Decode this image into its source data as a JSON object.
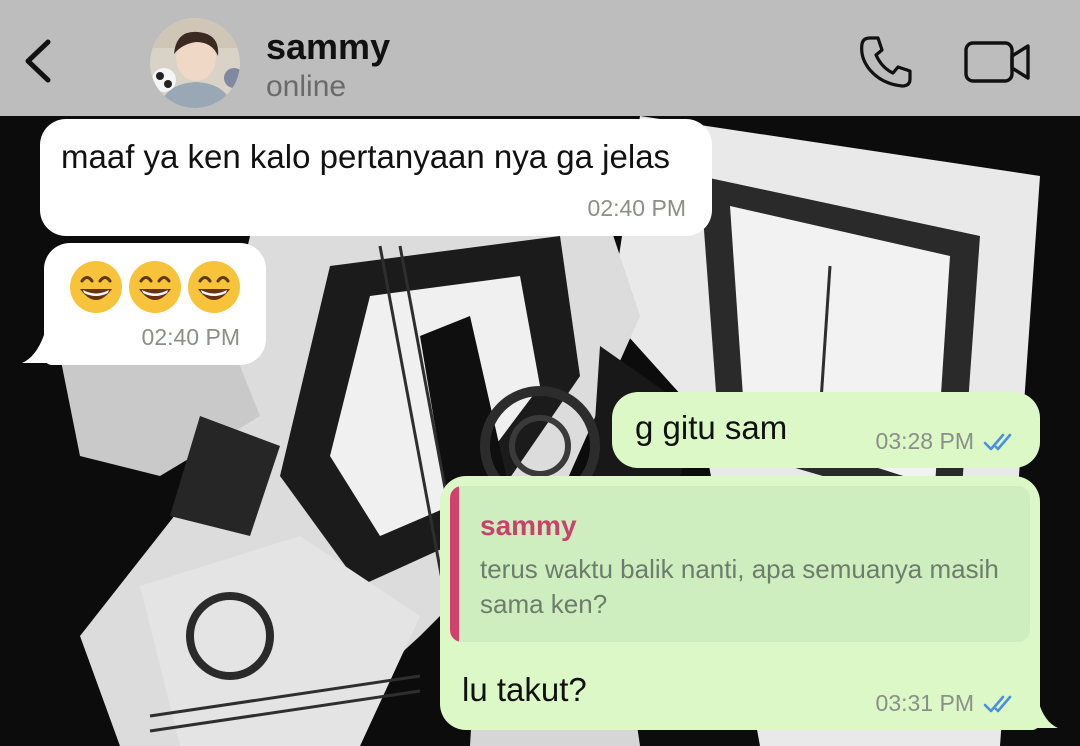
{
  "header": {
    "contact_name": "sammy",
    "status": "online"
  },
  "messages": [
    {
      "direction": "incoming",
      "text": "maaf ya ken kalo pertanyaan nya ga jelas",
      "time": "02:40 PM"
    },
    {
      "direction": "incoming",
      "emojis": [
        "grinning-face-with-smiling-eyes",
        "grinning-face-with-smiling-eyes",
        "grinning-face-with-smiling-eyes"
      ],
      "time": "02:40 PM"
    },
    {
      "direction": "outgoing",
      "text": "g gitu sam",
      "time": "03:28 PM",
      "status": "read"
    },
    {
      "direction": "outgoing",
      "quote": {
        "author": "sammy",
        "text": "terus waktu balik nanti, apa semuanya masih sama ken?"
      },
      "text": "lu takut?",
      "time": "03:31 PM",
      "status": "read"
    }
  ],
  "colors": {
    "header_bg": "#bdbdbd",
    "incoming_bubble": "#ffffff",
    "outgoing_bubble": "#dcf8c6",
    "quote_accent": "#d2416d",
    "read_ticks": "#4a90e2"
  }
}
